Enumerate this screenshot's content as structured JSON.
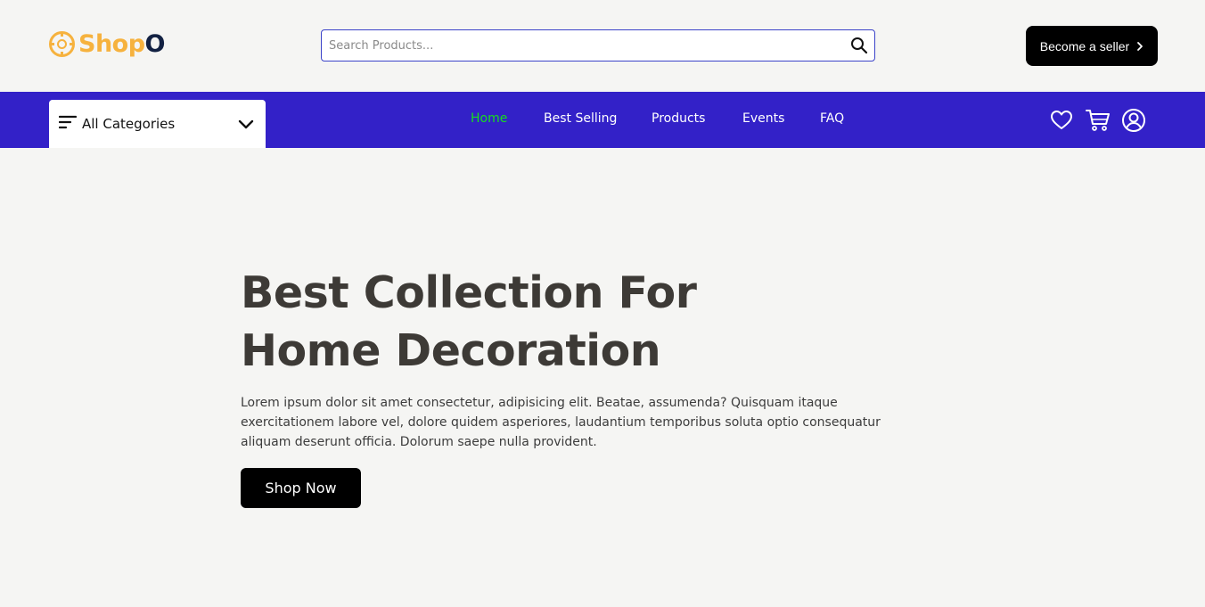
{
  "brand": {
    "logo_shop": "Shop",
    "logo_o": "O",
    "colors": {
      "accent": "#f6b23e",
      "dark": "#122142",
      "nav": "#3321c8",
      "active": "#17dd1f"
    }
  },
  "search": {
    "placeholder": "Search Products...",
    "value": "",
    "icon": "search-icon"
  },
  "header": {
    "seller_label": "Become a seller"
  },
  "navbar": {
    "categories_label": "All Categories",
    "links": [
      {
        "label": "Home",
        "active": true
      },
      {
        "label": "Best Selling",
        "active": false
      },
      {
        "label": "Products",
        "active": false
      },
      {
        "label": "Events",
        "active": false
      },
      {
        "label": "FAQ",
        "active": false
      }
    ],
    "icons": [
      "heart-icon",
      "cart-icon",
      "user-icon"
    ]
  },
  "hero": {
    "title_line1": "Best Collection For",
    "title_line2": "Home Decoration",
    "description": "Lorem ipsum dolor sit amet consectetur, adipisicing elit. Beatae, assumenda? Quisquam itaque exercitationem labore vel, dolore quidem asperiores, laudantium temporibus soluta optio consequatur aliquam deserunt officia. Dolorum saepe nulla provident.",
    "cta_label": "Shop Now"
  }
}
